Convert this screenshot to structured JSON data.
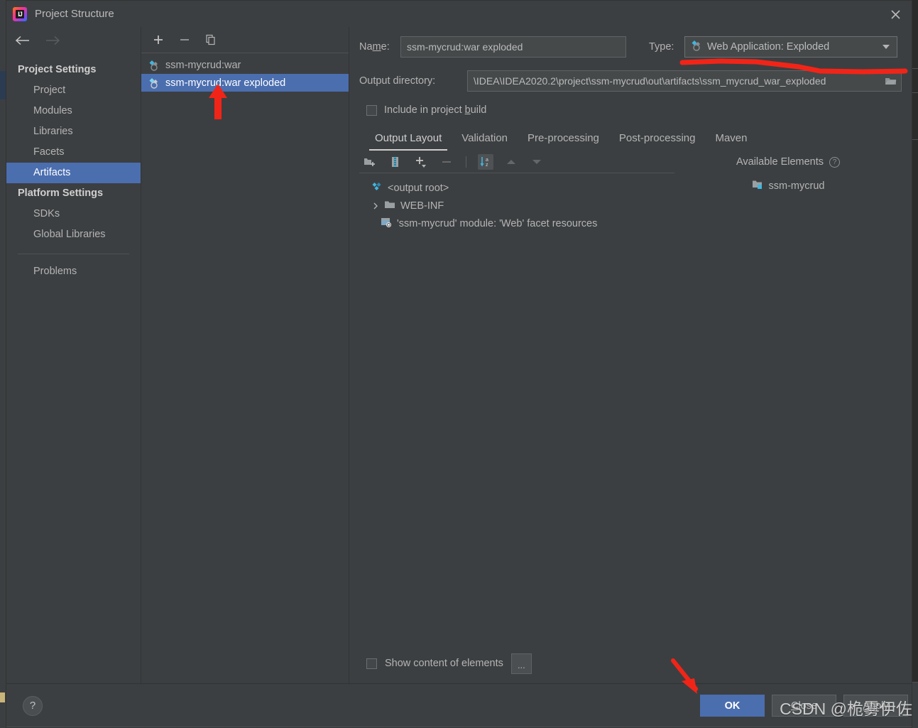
{
  "window": {
    "title": "Project Structure",
    "app_icon": "intellij-idea-icon",
    "close_icon": "close-icon"
  },
  "sidebar": {
    "back_icon": "arrow-left-icon",
    "forward_icon": "arrow-right-icon",
    "groups": [
      {
        "label": "Project Settings",
        "items": [
          {
            "label": "Project",
            "selected": false
          },
          {
            "label": "Modules",
            "selected": false
          },
          {
            "label": "Libraries",
            "selected": false
          },
          {
            "label": "Facets",
            "selected": false
          },
          {
            "label": "Artifacts",
            "selected": true
          }
        ]
      },
      {
        "label": "Platform Settings",
        "items": [
          {
            "label": "SDKs",
            "selected": false
          },
          {
            "label": "Global Libraries",
            "selected": false
          }
        ]
      }
    ],
    "problems_label": "Problems"
  },
  "artifacts_panel": {
    "toolbar": [
      {
        "icon": "plus-icon",
        "tooltip": "Add"
      },
      {
        "icon": "minus-icon",
        "tooltip": "Remove"
      },
      {
        "icon": "copy-icon",
        "tooltip": "Copy"
      }
    ],
    "items": [
      {
        "label": "ssm-mycrud:war",
        "icon": "artifact-icon",
        "selected": false
      },
      {
        "label": "ssm-mycrud:war exploded",
        "icon": "artifact-icon",
        "selected": true
      }
    ]
  },
  "detail": {
    "name_label": "Name:",
    "name_label_mnemonic": "m",
    "name_value": "ssm-mycrud:war exploded",
    "type_label": "Type:",
    "type_value": "Web Application: Exploded",
    "type_icon": "artifact-icon",
    "type_caret_icon": "chevron-down-icon",
    "output_dir_label": "Output directory:",
    "output_dir_value": "\\IDEA\\IDEA2020.2\\project\\ssm-mycrud\\out\\artifacts\\ssm_mycrud_war_exploded",
    "folder_icon": "folder-browse-icon",
    "include_in_build_label": "Include in project build",
    "include_in_build_mnemonic": "b",
    "include_in_build_checked": false,
    "tabs": [
      {
        "label": "Output Layout",
        "active": true
      },
      {
        "label": "Validation",
        "active": false
      },
      {
        "label": "Pre-processing",
        "active": false
      },
      {
        "label": "Post-processing",
        "active": false
      },
      {
        "label": "Maven",
        "active": false
      }
    ],
    "layout_toolbar": [
      {
        "icon": "add-directory-icon",
        "active": false
      },
      {
        "icon": "add-archive-icon",
        "active": false
      },
      {
        "icon": "add-copy-icon",
        "active": false
      },
      {
        "icon": "remove-icon",
        "active": false
      },
      {
        "icon": "sort-alphabetically-icon",
        "active": true
      },
      {
        "icon": "move-up-icon",
        "active": false
      },
      {
        "icon": "move-down-icon",
        "active": false
      }
    ],
    "output_tree": [
      {
        "label": "<output root>",
        "icon": "artifact-root-icon",
        "indent": 0,
        "expandable": false
      },
      {
        "label": "WEB-INF",
        "icon": "folder-icon",
        "indent": 1,
        "expandable": true
      },
      {
        "label": "'ssm-mycrud' module: 'Web' facet resources",
        "icon": "web-facet-icon",
        "indent": 2,
        "expandable": false
      }
    ],
    "available_elements_label": "Available Elements",
    "available_help_icon": "help-circle-icon",
    "available_items": [
      {
        "label": "ssm-mycrud",
        "icon": "module-icon"
      }
    ],
    "show_content_label": "Show content of elements",
    "show_content_checked": false,
    "ellipsis_label": "..."
  },
  "footer": {
    "help_label": "?",
    "help_icon": "help-circle-icon",
    "buttons": [
      {
        "label": "OK",
        "primary": true,
        "mnemonic": ""
      },
      {
        "label": "Close",
        "primary": false,
        "mnemonic": "C"
      },
      {
        "label": "Apply",
        "primary": false,
        "mnemonic": "A"
      }
    ]
  },
  "annotations": {
    "arrow_artifact": "red-arrow-up-annotation",
    "underline_type": "red-underline-annotation",
    "arrow_ok": "red-arrow-down-annotation",
    "watermark": "CSDN @桅雾伊佐"
  },
  "colors": {
    "dialog_bg": "#3c3f41",
    "selection_blue": "#4b6eaf",
    "text": "#b4b4b4",
    "input_bg": "#45494a",
    "annotation_red": "#f22418",
    "icon_blue": "#40b6e0"
  }
}
